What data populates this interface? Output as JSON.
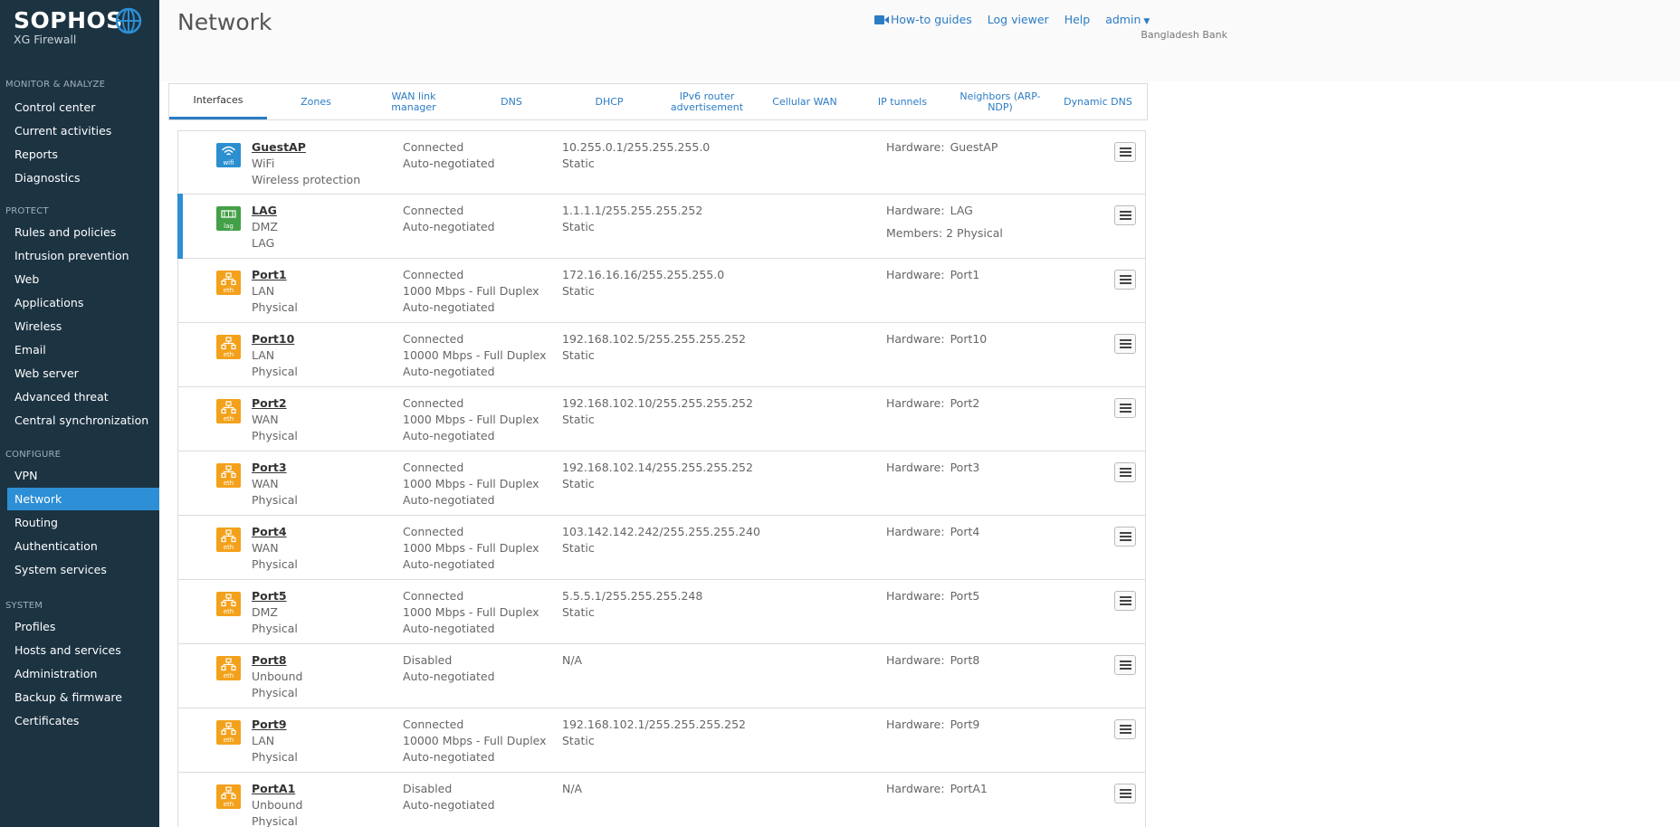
{
  "brand": {
    "name": "SOPHOS",
    "product": "XG Firewall"
  },
  "sidebar": {
    "sections": [
      {
        "title": "MONITOR & ANALYZE",
        "items": [
          "Control center",
          "Current activities",
          "Reports",
          "Diagnostics"
        ]
      },
      {
        "title": "PROTECT",
        "items": [
          "Rules and policies",
          "Intrusion prevention",
          "Web",
          "Applications",
          "Wireless",
          "Email",
          "Web server",
          "Advanced threat",
          "Central synchronization"
        ]
      },
      {
        "title": "CONFIGURE",
        "items": [
          "VPN",
          "Network",
          "Routing",
          "Authentication",
          "System services"
        ]
      },
      {
        "title": "SYSTEM",
        "items": [
          "Profiles",
          "Hosts and services",
          "Administration",
          "Backup & firmware",
          "Certificates"
        ]
      }
    ],
    "active_item": "Network"
  },
  "header": {
    "title": "Network",
    "links": {
      "howto": "How-to guides",
      "logviewer": "Log viewer",
      "help": "Help",
      "user": "admin"
    },
    "org": "Bangladesh Bank"
  },
  "tabs": [
    "Interfaces",
    "Zones",
    "WAN link manager",
    "DNS",
    "DHCP",
    "IPv6 router advertisement",
    "Cellular WAN",
    "IP tunnels",
    "Neighbors (ARP-NDP)",
    "Dynamic DNS"
  ],
  "active_tab": "Interfaces",
  "hardware_label": "Hardware:",
  "interfaces": [
    {
      "name": "GuestAP",
      "icon": "wifi",
      "icon_label": "wifi",
      "zone": "WiFi",
      "type": "Wireless protection",
      "status": "Connected",
      "speed": "",
      "negotiation": "Auto-negotiated",
      "ip": "10.255.0.1/255.255.255.0",
      "mode": "Static",
      "hardware": "GuestAP",
      "members": ""
    },
    {
      "name": "LAG",
      "icon": "lag",
      "icon_label": "lag",
      "zone": "DMZ",
      "type": "LAG",
      "status": "Connected",
      "speed": "",
      "negotiation": "Auto-negotiated",
      "ip": "1.1.1.1/255.255.255.252",
      "mode": "Static",
      "hardware": "LAG",
      "members": "Members: 2 Physical"
    },
    {
      "name": "Port1",
      "icon": "eth",
      "icon_label": "eth",
      "zone": "LAN",
      "type": "Physical",
      "status": "Connected",
      "speed": "1000 Mbps - Full Duplex",
      "negotiation": "Auto-negotiated",
      "ip": "172.16.16.16/255.255.255.0",
      "mode": "Static",
      "hardware": "Port1",
      "members": ""
    },
    {
      "name": "Port10",
      "icon": "eth",
      "icon_label": "eth",
      "zone": "LAN",
      "type": "Physical",
      "status": "Connected",
      "speed": "10000 Mbps - Full Duplex",
      "negotiation": "Auto-negotiated",
      "ip": "192.168.102.5/255.255.255.252",
      "mode": "Static",
      "hardware": "Port10",
      "members": ""
    },
    {
      "name": "Port2",
      "icon": "eth",
      "icon_label": "eth",
      "zone": "WAN",
      "type": "Physical",
      "status": "Connected",
      "speed": "1000 Mbps - Full Duplex",
      "negotiation": "Auto-negotiated",
      "ip": "192.168.102.10/255.255.255.252",
      "mode": "Static",
      "hardware": "Port2",
      "members": ""
    },
    {
      "name": "Port3",
      "icon": "eth",
      "icon_label": "eth",
      "zone": "WAN",
      "type": "Physical",
      "status": "Connected",
      "speed": "1000 Mbps - Full Duplex",
      "negotiation": "Auto-negotiated",
      "ip": "192.168.102.14/255.255.255.252",
      "mode": "Static",
      "hardware": "Port3",
      "members": ""
    },
    {
      "name": "Port4",
      "icon": "eth",
      "icon_label": "eth",
      "zone": "WAN",
      "type": "Physical",
      "status": "Connected",
      "speed": "1000 Mbps - Full Duplex",
      "negotiation": "Auto-negotiated",
      "ip": "103.142.142.242/255.255.255.240",
      "mode": "Static",
      "hardware": "Port4",
      "members": ""
    },
    {
      "name": "Port5",
      "icon": "eth",
      "icon_label": "eth",
      "zone": "DMZ",
      "type": "Physical",
      "status": "Connected",
      "speed": "1000 Mbps - Full Duplex",
      "negotiation": "Auto-negotiated",
      "ip": "5.5.5.1/255.255.255.248",
      "mode": "Static",
      "hardware": "Port5",
      "members": ""
    },
    {
      "name": "Port8",
      "icon": "eth",
      "icon_label": "eth",
      "zone": "Unbound",
      "type": "Physical",
      "status": "Disabled",
      "speed": "",
      "negotiation": "Auto-negotiated",
      "ip": "N/A",
      "mode": "",
      "hardware": "Port8",
      "members": ""
    },
    {
      "name": "Port9",
      "icon": "eth",
      "icon_label": "eth",
      "zone": "LAN",
      "type": "Physical",
      "status": "Connected",
      "speed": "10000 Mbps - Full Duplex",
      "negotiation": "Auto-negotiated",
      "ip": "192.168.102.1/255.255.255.252",
      "mode": "Static",
      "hardware": "Port9",
      "members": ""
    },
    {
      "name": "PortA1",
      "icon": "eth",
      "icon_label": "eth",
      "zone": "Unbound",
      "type": "Physical",
      "status": "Disabled",
      "speed": "",
      "negotiation": "Auto-negotiated",
      "ip": "N/A",
      "mode": "",
      "hardware": "PortA1",
      "members": ""
    }
  ],
  "selected_interface": "LAG",
  "colors": {
    "sidebar_bg": "#1c3342",
    "accent": "#2d8fd5",
    "link": "#2b7cc4",
    "eth_icon": "#f3a11b",
    "wifi_icon": "#2b8fd0",
    "lag_icon": "#43a047"
  }
}
